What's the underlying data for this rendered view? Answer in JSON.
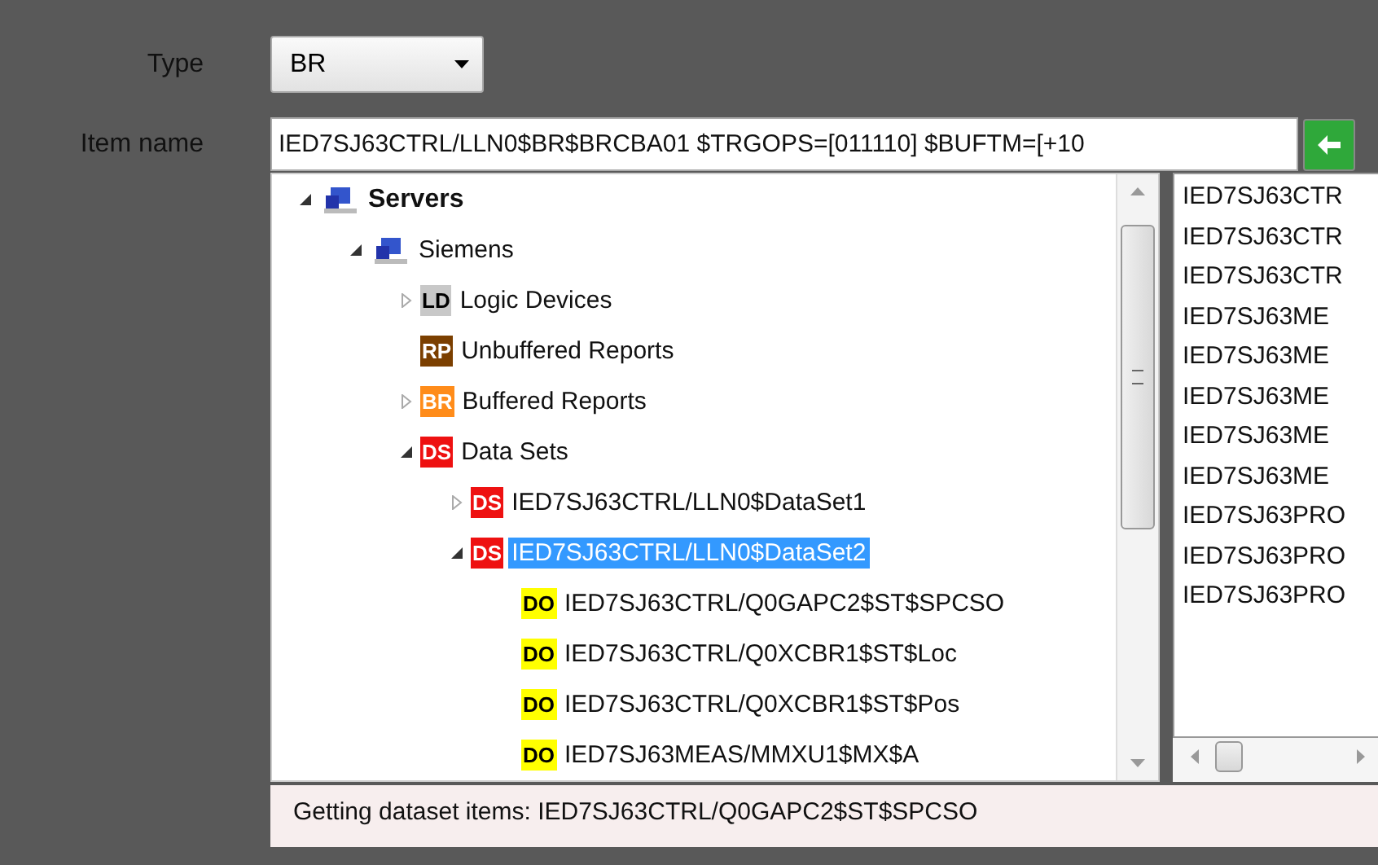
{
  "form": {
    "type_label": "Type",
    "type_value": "BR",
    "item_label": "Item name",
    "item_value": "IED7SJ63CTRL/LLN0$BR$BRCBA01 $TRGOPS=[011110] $BUFTM=[+10"
  },
  "tree": [
    {
      "label": "Servers",
      "kind": "server",
      "bold": true,
      "expanded": true,
      "selected": false,
      "children": [
        {
          "label": "Siemens",
          "kind": "server",
          "expanded": true,
          "selected": false,
          "children": [
            {
              "label": "Logic Devices",
              "kind": "badge",
              "badge": "LD",
              "color": "#c8c8c8",
              "expanded": false,
              "selected": false
            },
            {
              "label": "Unbuffered Reports",
              "kind": "badge",
              "badge": "RP",
              "color": "#7b3f00",
              "selected": false
            },
            {
              "label": "Buffered Reports",
              "kind": "badge",
              "badge": "BR",
              "color": "#ff8c1a",
              "expanded": false,
              "selected": false
            },
            {
              "label": "Data Sets",
              "kind": "badge",
              "badge": "DS",
              "color": "#ee1111",
              "expanded": true,
              "selected": false,
              "children": [
                {
                  "label": "IED7SJ63CTRL/LLN0$DataSet1",
                  "kind": "badge",
                  "badge": "DS",
                  "color": "#ee1111",
                  "expanded": false,
                  "selected": false
                },
                {
                  "label": "IED7SJ63CTRL/LLN0$DataSet2",
                  "kind": "badge",
                  "badge": "DS",
                  "color": "#ee1111",
                  "expanded": true,
                  "selected": true,
                  "children": [
                    {
                      "label": "IED7SJ63CTRL/Q0GAPC2$ST$SPCSO",
                      "kind": "badge",
                      "badge": "DO",
                      "color": "#ffff00",
                      "selected": false
                    },
                    {
                      "label": "IED7SJ63CTRL/Q0XCBR1$ST$Loc",
                      "kind": "badge",
                      "badge": "DO",
                      "color": "#ffff00",
                      "selected": false
                    },
                    {
                      "label": "IED7SJ63CTRL/Q0XCBR1$ST$Pos",
                      "kind": "badge",
                      "badge": "DO",
                      "color": "#ffff00",
                      "selected": false
                    },
                    {
                      "label": "IED7SJ63MEAS/MMXU1$MX$A",
                      "kind": "badge",
                      "badge": "DO",
                      "color": "#ffff00",
                      "selected": false
                    }
                  ]
                }
              ]
            }
          ]
        }
      ]
    }
  ],
  "list": [
    "IED7SJ63CTR",
    "IED7SJ63CTR",
    "IED7SJ63CTR",
    "IED7SJ63ME",
    "IED7SJ63ME",
    "IED7SJ63ME",
    "IED7SJ63ME",
    "IED7SJ63ME",
    "IED7SJ63PRO",
    "IED7SJ63PRO",
    "IED7SJ63PRO"
  ],
  "status_bar": "Getting dataset items: IED7SJ63CTRL/Q0GAPC2$ST$SPCSO"
}
